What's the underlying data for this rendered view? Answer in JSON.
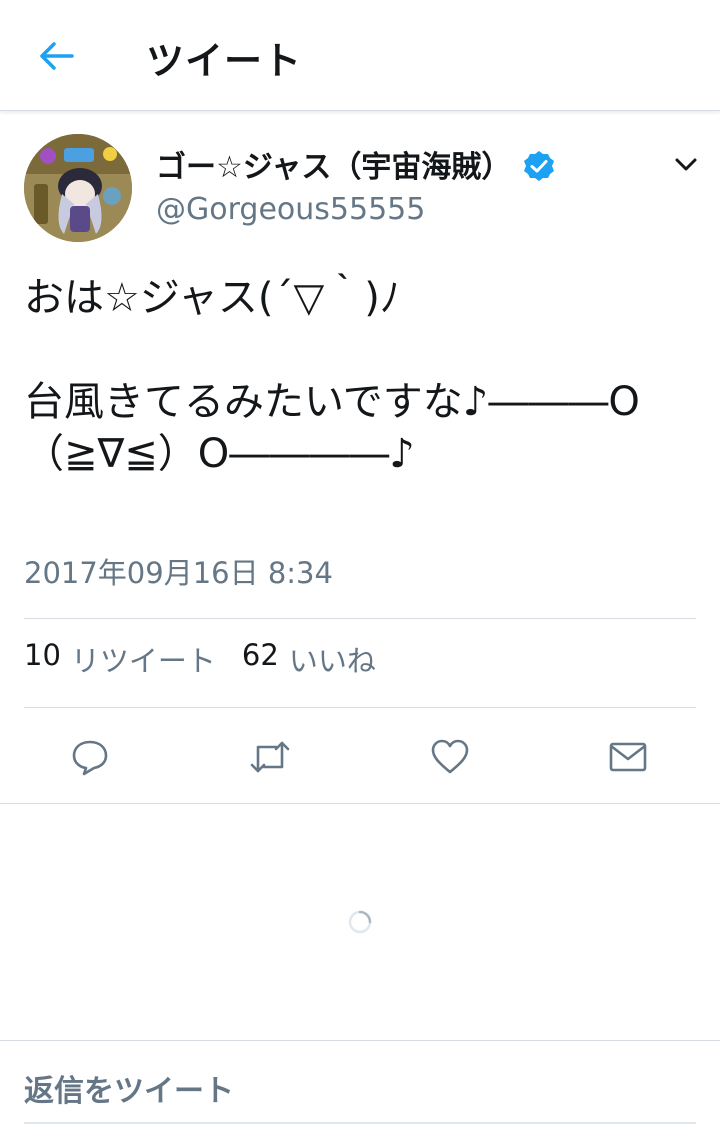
{
  "header": {
    "title": "ツイート"
  },
  "tweet": {
    "author_name": "ゴー☆ジャス（宇宙海賊）",
    "author_handle": "@Gorgeous55555",
    "text": "おは☆ジャス(´▽｀)ﾉ\n\n台風きてるみたいですな♪―――O（≧∇≦）O――――♪",
    "timestamp": "2017年09月16日 8:34",
    "retweet_count": "10",
    "retweet_label": "リツイート",
    "like_count": "62",
    "like_label": "いいね"
  },
  "reply": {
    "placeholder": "返信をツイート"
  },
  "icons": {
    "back": "back-arrow-icon",
    "verified": "verified-badge-icon",
    "caret": "chevron-down-icon",
    "reply": "reply-icon",
    "retweet": "retweet-icon",
    "like": "heart-icon",
    "dm": "envelope-icon"
  },
  "colors": {
    "accent": "#1da1f2",
    "secondary_text": "#657786",
    "divider": "#d7dde2"
  }
}
